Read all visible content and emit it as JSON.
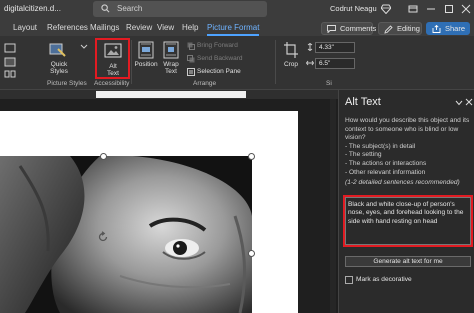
{
  "titlebar": {
    "doc_name": "digitalcitizen.d...",
    "search_placeholder": "Search",
    "user": "Codrut Neagu"
  },
  "tabs": [
    {
      "label": "Layout"
    },
    {
      "label": "References"
    },
    {
      "label": "Mailings"
    },
    {
      "label": "Review"
    },
    {
      "label": "View"
    },
    {
      "label": "Help"
    },
    {
      "label": "Picture Format",
      "active": true
    }
  ],
  "actions": {
    "comments": "Comments",
    "editing": "Editing",
    "share": "Share"
  },
  "ribbon": {
    "quick_styles": "Quick\nStyles",
    "picture_styles_group": "Picture Styles",
    "alt_text": "Alt\nText",
    "accessibility_group": "Accessibility",
    "position": "Position",
    "wrap_text": "Wrap\nText",
    "bring_forward": "Bring Forward",
    "send_backward": "Send Backward",
    "selection_pane": "Selection Pane",
    "arrange_group": "Arrange",
    "crop": "Crop",
    "height": "4.33\"",
    "width": "6.5\"",
    "size_group": "Si"
  },
  "pane": {
    "title": "Alt Text",
    "question": "How would you describe this object and its context to someone who is blind or low vision?",
    "hints": [
      "- The subject(s) in detail",
      "- The setting",
      "- The actions or interactions",
      "- Other relevant information"
    ],
    "recommended": "(1-2 detailed sentences recommended)",
    "alt_text_value": "Black and white close-up of person's nose, eyes, and forehead looking to the side with hand resting on head",
    "generate_button": "Generate alt text for me",
    "decorative_label": "Mark as decorative"
  },
  "colors": {
    "accent": "#4ea3ff",
    "highlight": "#e21b22"
  }
}
